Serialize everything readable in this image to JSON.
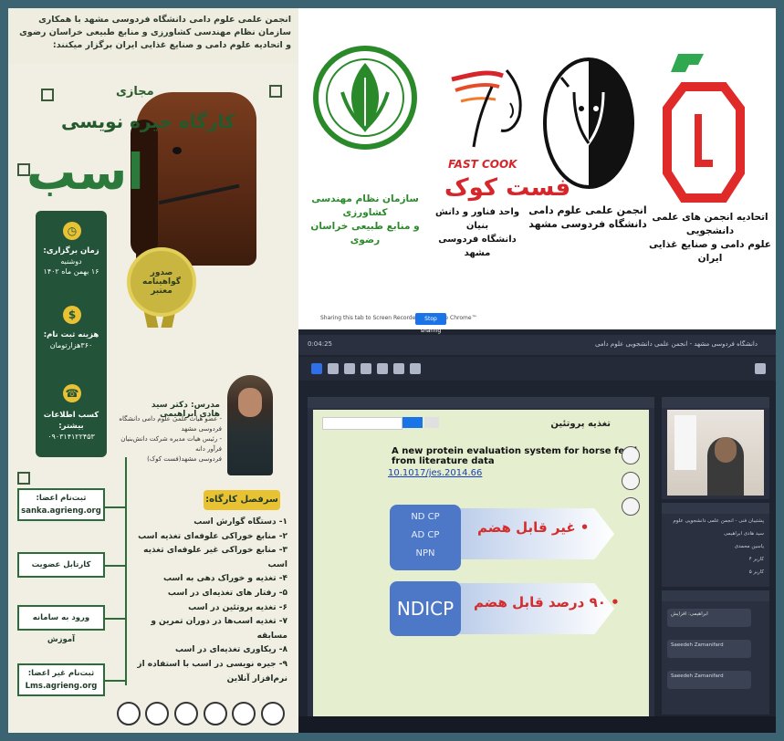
{
  "poster": {
    "intro": "انجمن علمی علوم دامی دانشگاه فردوسی مشهد با همکاری سازمان نظام مهندسی کشاورزی و منابع طبیعی خراسان رضوی و اتحادیه علوم دامی و صنایع غذایی ایران برگزار میکنند:",
    "virtual": "مجازی",
    "workshop": "کارگاه جیره نویسی",
    "horse": "اسب",
    "certificate_line1": "صدور",
    "certificate_line2": "گواهینامه",
    "certificate_line3": "معتبر",
    "info": {
      "when_label": "زمان برگزاری:",
      "when_day": "دوشنبه",
      "when_date": "۱۶ بهمن ماه ۱۴۰۲",
      "fee_label": "هزینه ثبت نام:",
      "fee_value": "۳۶۰هزارتومان",
      "contact_label": "کسب اطلاعات بیشتر:",
      "contact_value": "۰۹۰۳۱۴۱۲۲۴۵۳"
    },
    "register_members_label": "ثبت‌نام اعضا:",
    "register_members_site": "sanka.agrieng.org",
    "membership_card": "کارتابل عضویت",
    "lms_login": "ورود به سامانه آموزش",
    "register_nonmembers_label": "ثبت‌نام غیر اعضا:",
    "register_nonmembers_site": "Lms.agrieng.org",
    "teacher_name": "مدرس: دکتر سید هادی ابراهیمی",
    "teacher_desc1": "- عضو هیات علمی علوم دامی دانشگاه فردوسی مشهد",
    "teacher_desc2": "- رئیس هیات مدیره شرکت دانش‌بنیان فرآور دانه",
    "teacher_desc3": "فردوسی مشهد(فست کوک)",
    "outline_title": "سرفصل کارگاه:",
    "outline": [
      "۱- دستگاه گوارش اسب",
      "۲- منابع خوراکی علوفه‌ای تغذیه اسب",
      "۳- منابع خوراکی غیر علوفه‌ای تغذیه اسب",
      "۴- تغذیه و خوراک دهی به اسب",
      "۵- رفتار های تغذیه‌ای در اسب",
      "۶- تغذیه پروتئین در اسب",
      "۷- تغذیه اسب‌ها در دوران تمرین و مسابقه",
      "۸- ریکاوری تغذیه‌ای در اسب",
      "۹- جیره نویسی در اسب با استفاده از",
      "نرم‌افزار آنلاین"
    ]
  },
  "logos": {
    "nezam_line1": "سازمان نظام مهندسی کشاورزی",
    "nezam_line2": "و منابع طبیعی خراسان رضوی",
    "fastcook_en": "FAST COOK",
    "fastcook_fa": "فست کوک",
    "fastcook_line1": "واحد فناور و دانش بنیان",
    "fastcook_line2": "دانشگاه فردوسی مشهد",
    "anjoman_line1": "انجمن علمی علوم دامی",
    "anjoman_line2": "دانشگاه فردوسی مشهد",
    "etehadie_line1": "اتحادیه انجمن های علمی دانشجویی",
    "etehadie_line2": "علوم دامی و صنایع غذایی ایران"
  },
  "screen": {
    "share_text": "Sharing this tab to Screen Recorder for Google Chrome™",
    "stop_sharing": "Stop sharing",
    "room_title": "دانشگاه فردوسی مشهد - انجمن علمی دانشجویی علوم دامی",
    "timer": "0:04:25",
    "slide": {
      "heading": "تغذیه پروتئین",
      "title": "A new protein evaluation system for horse feed from literature data",
      "doi": "10.1017/jes.2014.66",
      "box1_lines": [
        "ND CP",
        "AD CP",
        "NPN"
      ],
      "red1": "• غیر قابل هضم",
      "box2": "NDICP",
      "red2": "• ۹۰ درصد قابل هضم"
    },
    "participants": [
      "پشتیبان فنی - انجمن علمی دانشجویی علوم دامی",
      "سید هادی ابراهیمی",
      "یاسین محمدی",
      "کاربر ۴",
      "کاربر ۵"
    ],
    "chat": [
      "ابراهیمی: افزایش",
      "Saeedeh Zamanifard",
      "Saeedeh Zamanifard"
    ]
  }
}
